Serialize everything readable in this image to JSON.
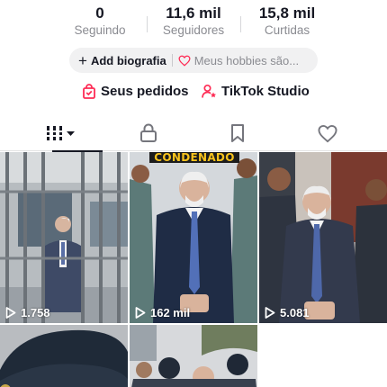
{
  "stats": [
    {
      "value": "0",
      "label": "Seguindo"
    },
    {
      "value": "11,6 mil",
      "label": "Seguidores"
    },
    {
      "value": "15,8 mil",
      "label": "Curtidas"
    }
  ],
  "bio": {
    "add_label": "Add biografia",
    "hobbies_placeholder": "Meus hobbies são..."
  },
  "links": {
    "orders_label": "Seus pedidos",
    "studio_label": "TikTok Studio"
  },
  "tabs": [
    {
      "icon": "grid-icon",
      "selected": true
    },
    {
      "icon": "lock-icon",
      "selected": false
    },
    {
      "icon": "bookmark-icon",
      "selected": false
    },
    {
      "icon": "heart-icon",
      "selected": false
    }
  ],
  "videos": [
    {
      "views": "1.758",
      "banner": ""
    },
    {
      "views": "162 mil",
      "banner": "CONDENADO"
    },
    {
      "views": "5.081",
      "banner": ""
    },
    {
      "views": "",
      "banner": ""
    },
    {
      "views": "",
      "banner": ""
    }
  ],
  "colors": {
    "text": "#161823",
    "secondary": "#8a8b91",
    "accent": "#fe2c55",
    "pill_bg": "#f1f1f2",
    "banner_text": "#f7c21c"
  }
}
